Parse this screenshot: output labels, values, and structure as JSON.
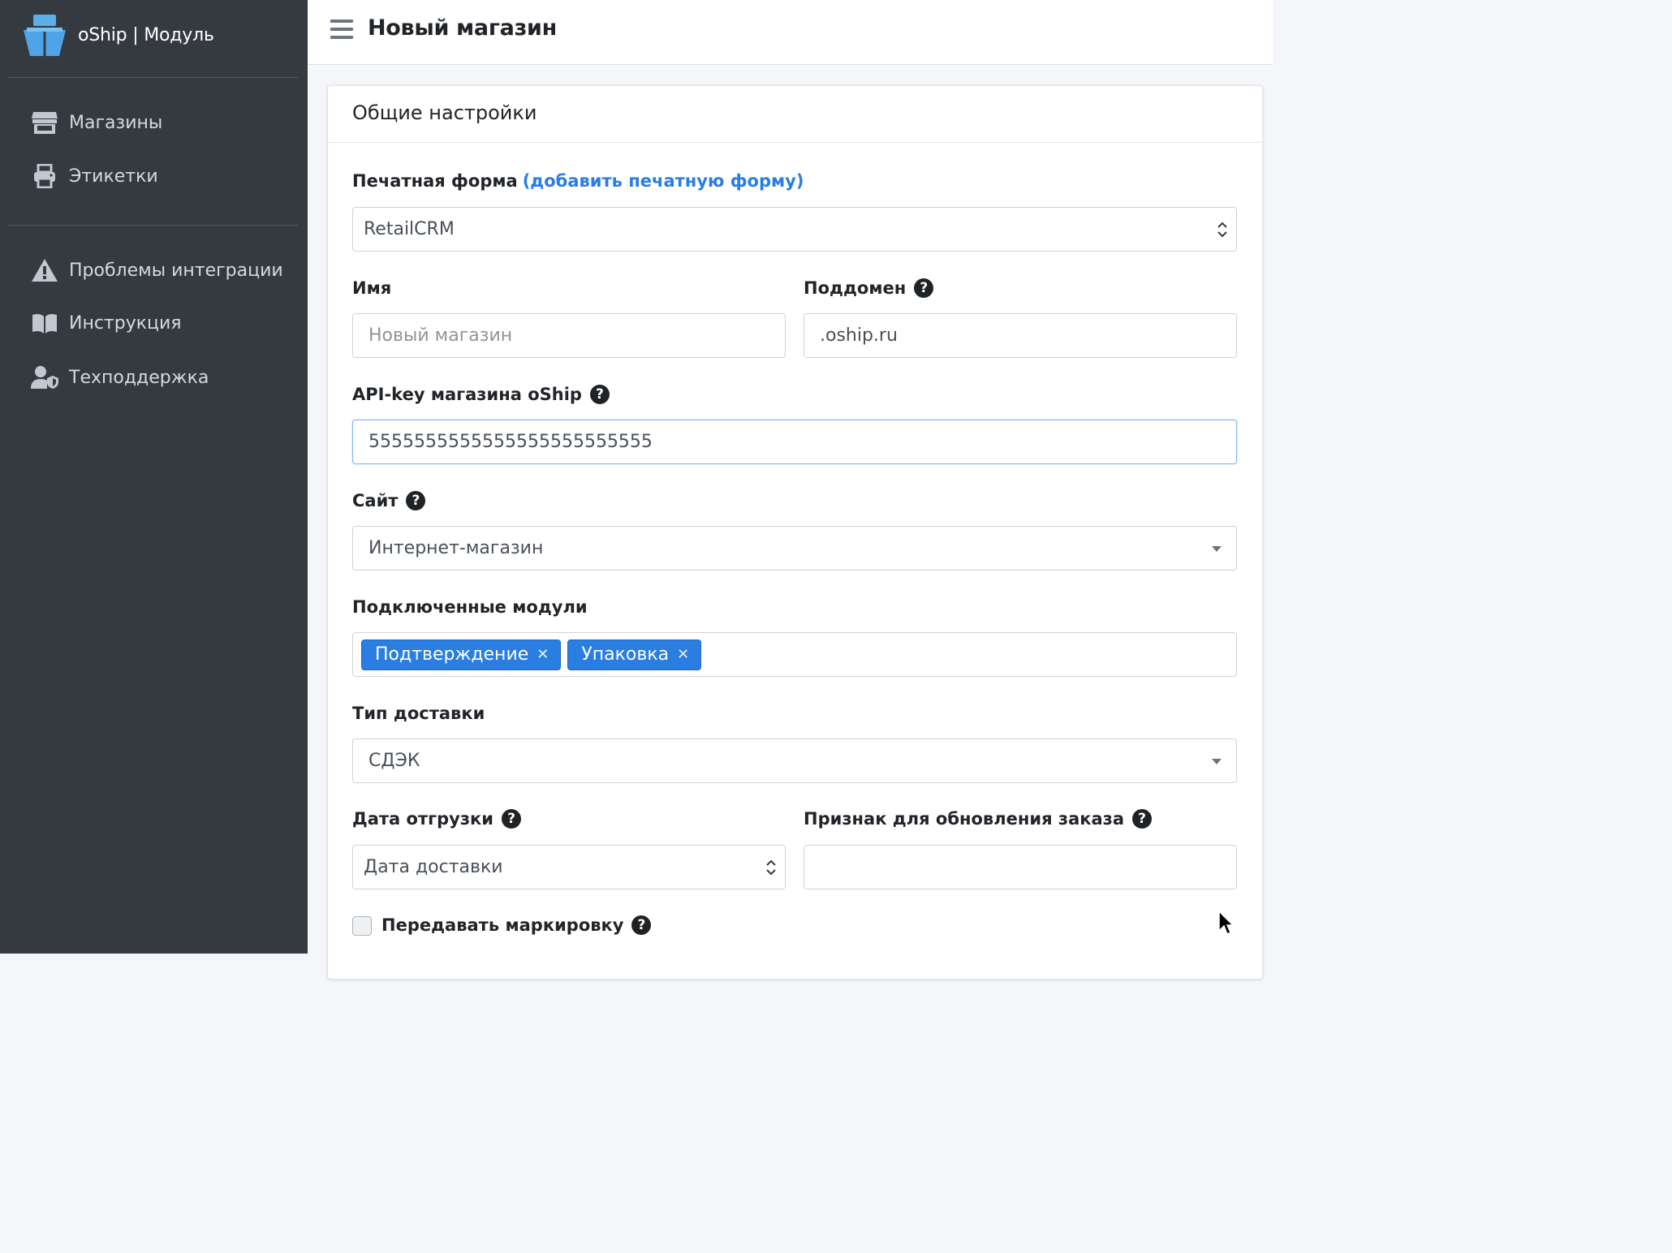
{
  "brand": {
    "title": "oShip | Модуль"
  },
  "sidebar": {
    "items": [
      {
        "label": "Магазины",
        "icon": "store-icon"
      },
      {
        "label": "Этикетки",
        "icon": "print-icon"
      },
      {
        "label": "Проблемы интеграции",
        "icon": "warning-icon"
      },
      {
        "label": "Инструкция",
        "icon": "book-icon"
      },
      {
        "label": "Техподдержка",
        "icon": "support-icon"
      }
    ]
  },
  "header": {
    "title": "Новый магазин"
  },
  "card": {
    "title": "Общие настройки"
  },
  "form": {
    "print_form": {
      "label": "Печатная форма",
      "link": "(добавить печатную форму)",
      "value": "RetailCRM"
    },
    "name": {
      "label": "Имя",
      "placeholder": "Новый магазин"
    },
    "subdomain": {
      "label": "Поддомен",
      "value": ".oship.ru"
    },
    "api_key": {
      "label": "API-key магазина oShip",
      "value": "5555555555555555555555555"
    },
    "site": {
      "label": "Сайт",
      "value": "Интернет-магазин"
    },
    "modules": {
      "label": "Подключенные модули",
      "tags": [
        "Подтверждение",
        "Упаковка"
      ]
    },
    "delivery_type": {
      "label": "Тип доставки",
      "value": "СДЭК"
    },
    "shipment_date": {
      "label": "Дата отгрузки",
      "value": "Дата доставки"
    },
    "update_flag": {
      "label": "Признак для обновления заказа",
      "value": ""
    },
    "marking": {
      "label": "Передавать маркировку",
      "checked": false
    }
  },
  "colors": {
    "sidebar": "#343a40",
    "accent": "#2a7de1",
    "logo": "#4fa3e8"
  }
}
